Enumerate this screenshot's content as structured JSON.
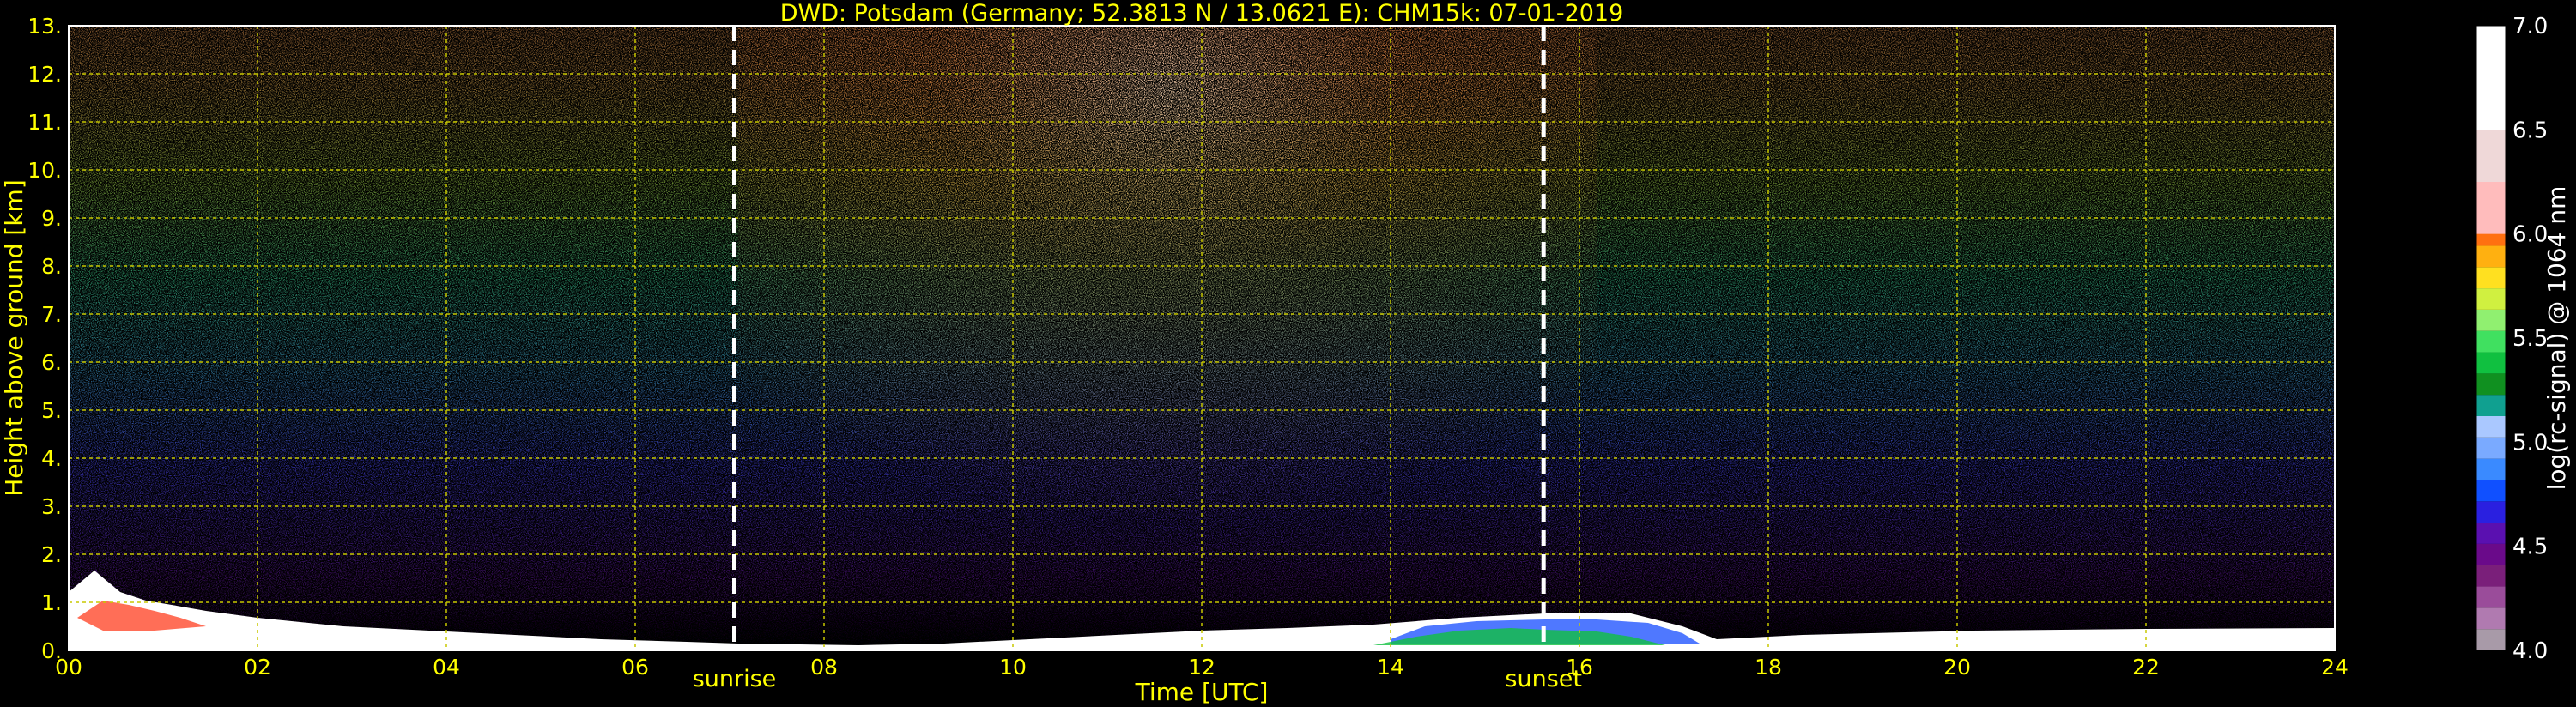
{
  "chart_data": {
    "type": "heatmap",
    "title": "DWD: Potsdam (Germany; 52.3813 N / 13.0621 E):    CHM15k: 07-01-2019",
    "xlabel": "Time [UTC]",
    "ylabel": "Height above ground [km]",
    "xlim": [
      0,
      24
    ],
    "ylim": [
      0,
      13
    ],
    "x_ticks": [
      "00",
      "02",
      "04",
      "06",
      "08",
      "10",
      "12",
      "14",
      "16",
      "18",
      "20",
      "22",
      "24"
    ],
    "y_ticks": [
      "0.",
      "1.",
      "2.",
      "3.",
      "4.",
      "5.",
      "6.",
      "7.",
      "8.",
      "9.",
      "10.",
      "11.",
      "12.",
      "13."
    ],
    "grid": true,
    "markers": [
      {
        "label": "sunrise",
        "x": 7.05
      },
      {
        "label": "sunset",
        "x": 15.62
      }
    ],
    "colorbar": {
      "label": "log(rc-signal) @ 1064 nm",
      "range": [
        4.0,
        7.0
      ],
      "ticks": [
        "4.0",
        "4.5",
        "5.0",
        "5.5",
        "6.0",
        "6.5",
        "7.0"
      ],
      "colors": [
        "#a89aa8",
        "#b07ab0",
        "#9a4c9a",
        "#7a1f7a",
        "#6a0a8a",
        "#5a10b0",
        "#2a20e0",
        "#1050ff",
        "#3a8aff",
        "#7aaaff",
        "#aac8ff",
        "#10a090",
        "#109020",
        "#10c040",
        "#40e060",
        "#90f070",
        "#d0f040",
        "#ffe020",
        "#ffb010",
        "#ff7010",
        "#ff3010",
        "#ff0000",
        "#ffbcbc",
        "#efd8d8",
        "#ffffff"
      ]
    }
  }
}
